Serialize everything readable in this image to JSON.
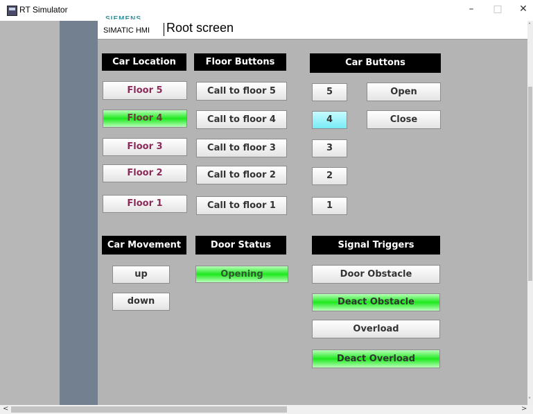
{
  "window": {
    "title": "RT Simulator",
    "minimize": "–",
    "maximize": "□",
    "close": "✕"
  },
  "header": {
    "brand": "SIEMENS",
    "product": "SIMATIC HMI",
    "screen_title": "Root screen"
  },
  "scrollbars": {
    "left_arrow": "<",
    "right_arrow": ">",
    "up_arrow": "˄",
    "down_arrow": "˅"
  },
  "car_location": {
    "label": "Car Location",
    "floors": [
      {
        "label": "Floor 5",
        "active": false
      },
      {
        "label": "Floor 4",
        "active": true
      },
      {
        "label": "Floor 3",
        "active": false
      },
      {
        "label": "Floor 2",
        "active": false
      },
      {
        "label": "Floor 1",
        "active": false
      }
    ]
  },
  "floor_buttons": {
    "label": "Floor Buttons",
    "buttons": [
      "Call to floor 5",
      "Call to floor 4",
      "Call to floor 3",
      "Call to floor 2",
      "Call to floor 1"
    ]
  },
  "car_buttons": {
    "label": "Car Buttons",
    "numbers": [
      {
        "label": "5",
        "active": false
      },
      {
        "label": "4",
        "active": true
      },
      {
        "label": "3",
        "active": false
      },
      {
        "label": "2",
        "active": false
      },
      {
        "label": "1",
        "active": false
      }
    ],
    "open": "Open",
    "close": "Close"
  },
  "car_movement": {
    "label": "Car Movement",
    "up": "up",
    "down": "down"
  },
  "door_status": {
    "label": "Door Status",
    "value": "Opening",
    "active": true
  },
  "signal_triggers": {
    "label": "Signal Triggers",
    "door_obstacle": "Door Obstacle",
    "deact_obstacle": "Deact Obstacle",
    "overload": "Overload",
    "deact_overload": "Deact Overload"
  },
  "colors": {
    "active_green": "#1ee81e",
    "active_cyan": "#77ecf6",
    "floor_text": "#8c2a5a",
    "nav_bar": "#72808f",
    "screen_bg": "#b4b4b4"
  }
}
